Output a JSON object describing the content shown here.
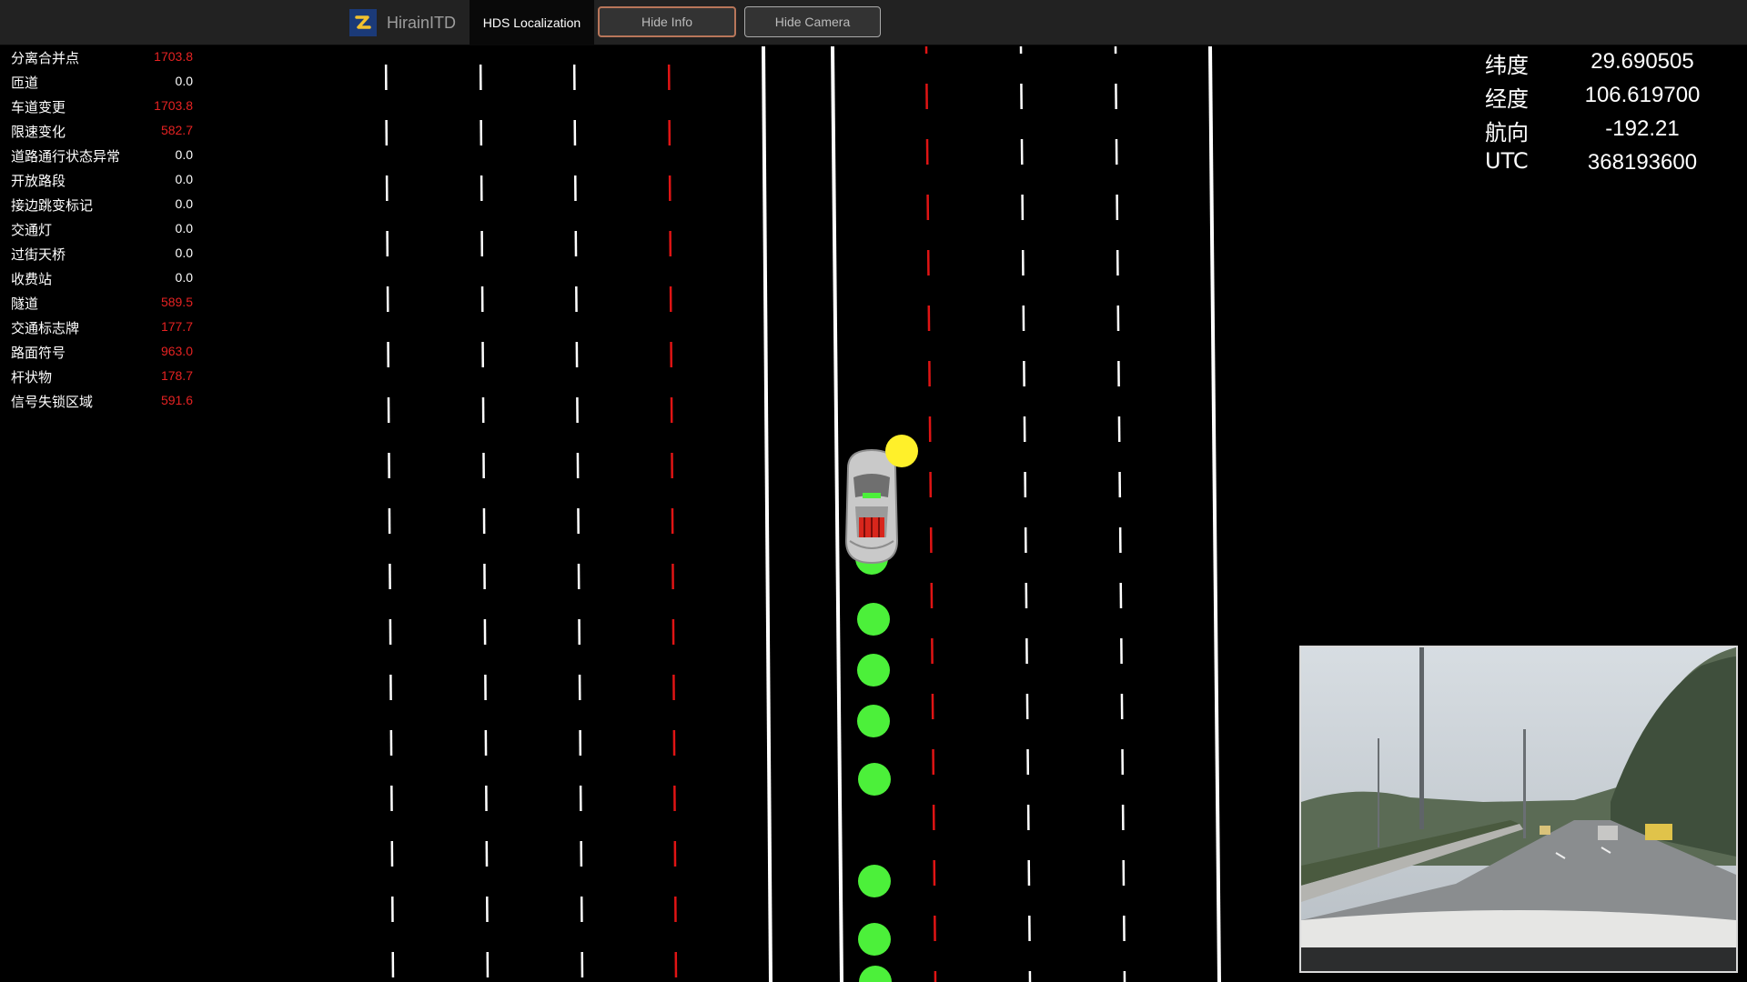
{
  "navbar": {
    "brand": "HirainITD",
    "active_tab": "HDS Localization",
    "hide_info_label": "Hide Info",
    "hide_camera_label": "Hide Camera"
  },
  "info": [
    {
      "label": "分离合并点",
      "value": "1703.8",
      "color": "#e52222"
    },
    {
      "label": "匝道",
      "value": "0.0",
      "color": "#ffffff"
    },
    {
      "label": "车道变更",
      "value": "1703.8",
      "color": "#e52222"
    },
    {
      "label": "限速变化",
      "value": "582.7",
      "color": "#e52222"
    },
    {
      "label": "道路通行状态异常",
      "value": "0.0",
      "color": "#ffffff"
    },
    {
      "label": "开放路段",
      "value": "0.0",
      "color": "#ffffff"
    },
    {
      "label": "接边跳变标记",
      "value": "0.0",
      "color": "#ffffff"
    },
    {
      "label": "交通灯",
      "value": "0.0",
      "color": "#ffffff"
    },
    {
      "label": "过街天桥",
      "value": "0.0",
      "color": "#ffffff"
    },
    {
      "label": "收费站",
      "value": "0.0",
      "color": "#ffffff"
    },
    {
      "label": "隧道",
      "value": "589.5",
      "color": "#e52222"
    },
    {
      "label": "交通标志牌",
      "value": "177.7",
      "color": "#e52222"
    },
    {
      "label": "路面符号",
      "value": "963.0",
      "color": "#e52222"
    },
    {
      "label": "杆状物",
      "value": "178.7",
      "color": "#e52222"
    },
    {
      "label": "信号失锁区域",
      "value": "591.6",
      "color": "#e52222"
    }
  ],
  "position": {
    "lat_label": "纬度",
    "lat_value": "29.690505",
    "lon_label": "经度",
    "lon_value": "106.619700",
    "heading_label": "航向",
    "heading_value": "-192.21",
    "utc_label": "UTC",
    "utc_value": "368193600"
  },
  "colors": {
    "lane_white": "#ffffff",
    "lane_red": "#e01414",
    "trajectory": "#4cf03a",
    "gnss_point": "#fff02a",
    "navbar_bg": "#222222"
  },
  "icons": {
    "logo": "hirain-logo",
    "vehicle": "car-icon"
  }
}
